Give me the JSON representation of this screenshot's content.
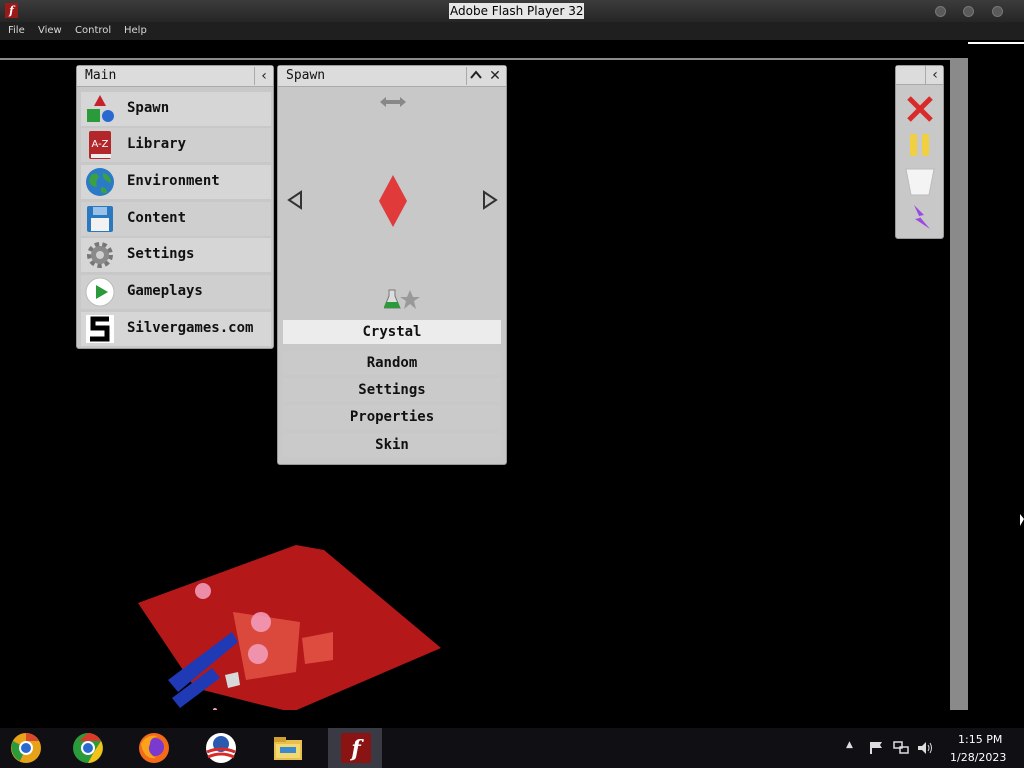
{
  "window": {
    "title": "Adobe Flash Player 32",
    "app_icon_glyph": "f"
  },
  "menubar": {
    "items": [
      "File",
      "View",
      "Control",
      "Help"
    ]
  },
  "main_panel": {
    "title": "Main",
    "collapse_glyph": "‹",
    "items": [
      {
        "label": "Spawn",
        "icon": "shapes-icon"
      },
      {
        "label": "Library",
        "icon": "book-icon"
      },
      {
        "label": "Environment",
        "icon": "globe-icon"
      },
      {
        "label": "Content",
        "icon": "floppy-disk-icon"
      },
      {
        "label": "Settings",
        "icon": "gear-icon"
      },
      {
        "label": "Gameplays",
        "icon": "play-icon"
      },
      {
        "label": "Silvergames.com",
        "icon": "silvergames-logo-icon"
      }
    ]
  },
  "spawn_panel": {
    "title": "Spawn",
    "minimize_glyph": "^",
    "close_glyph": "✕",
    "selected_item": "Crystal",
    "options": [
      "Random",
      "Settings",
      "Properties",
      "Skin"
    ]
  },
  "tools_panel": {
    "collapse_glyph": "‹",
    "tools": [
      "delete-tool-icon",
      "pause-icon",
      "bucket-icon",
      "lightning-icon"
    ]
  },
  "taskbar": {
    "apps": [
      "chrome-canary-icon",
      "chrome-icon",
      "firefox-icon",
      "obama-logo-icon",
      "file-explorer-icon",
      "flash-player-icon"
    ],
    "time": "1:15 PM",
    "date": "1/28/2023"
  },
  "colors": {
    "accent_red": "#e03a3a",
    "panel_bg": "#c8c8c8",
    "taskbar_bg": "#0f0f14"
  }
}
